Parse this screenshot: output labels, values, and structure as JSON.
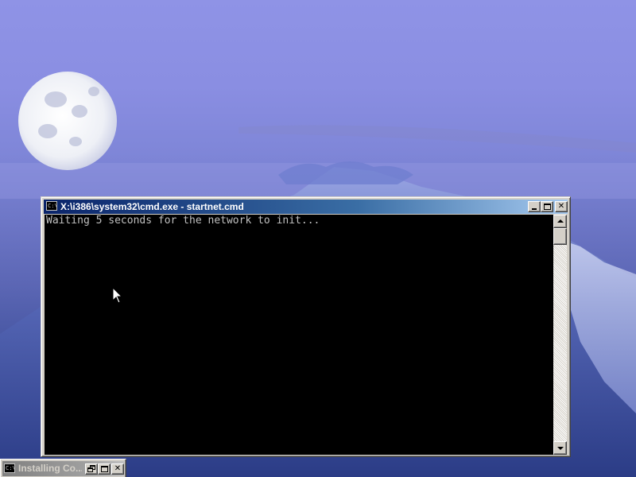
{
  "desktop": {
    "wallpaper": "moon-over-mountain",
    "colors": {
      "sky": "#8a8ee2",
      "mountain": "#3d4f9a"
    }
  },
  "console_window": {
    "title": "X:\\i386\\system32\\cmd.exe - startnet.cmd",
    "system_icon": "console-icon",
    "system_icon_text": "C:\\",
    "buttons": {
      "minimize": "minimize",
      "maximize": "maximize",
      "close": "✕"
    },
    "output_lines": [
      "Waiting 5 seconds for the network to init..."
    ],
    "colors": {
      "titlebar_start": "#0a246a",
      "titlebar_end": "#a6caf0",
      "console_bg": "#000000",
      "console_text": "#c0c0c0"
    }
  },
  "minimized_window": {
    "title": "Installing Co...",
    "system_icon": "console-icon",
    "system_icon_text": "C:\\",
    "buttons": {
      "restore": "restore",
      "maximize": "maximize",
      "close": "✕"
    }
  }
}
